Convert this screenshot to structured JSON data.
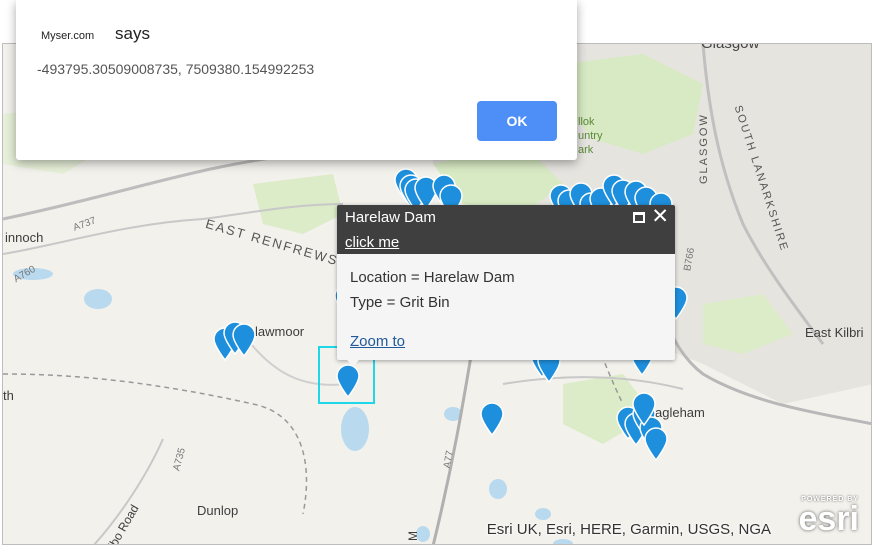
{
  "dialog": {
    "origin": "Myser.com",
    "says": "says",
    "message": "-493795.30509008735, 7509380.154992253",
    "ok_label": "OK"
  },
  "popup": {
    "title": "Harelaw Dam",
    "link": "click me",
    "location_line": "Location = Harelaw Dam",
    "type_line": "Type = Grit Bin",
    "zoom_label": "Zoom to"
  },
  "map": {
    "labels": {
      "glasgow_top": "Glasgow",
      "inchinnan": "innoch",
      "east_renfrewshire": "EAST RENFREWSHIRE",
      "a737": "A737",
      "a760": "A760",
      "lawmoor": "lawmoor",
      "ollok": "llok",
      "ountry": "untry",
      "ark": "ark",
      "glasgow_vertical": "GLASGOW",
      "south_lanarkshire": "SOUTH LANARKSHIRE",
      "east_kilbride": "East Kilbri",
      "eaglesham": "agleham",
      "th": "th",
      "a735": "A735",
      "a77": "A77",
      "b766": "B766",
      "lochlibo_road": "ochlibo Road",
      "dunlop": "Dunlop",
      "m": "M"
    },
    "attribution": "Esri UK, Esri, HERE, Garmin, USGS, NGA",
    "logo_powered": "POWERED BY",
    "logo_text": "esri",
    "pin_color": "#1e8fdc",
    "selection_color": "#1ed7e8"
  }
}
